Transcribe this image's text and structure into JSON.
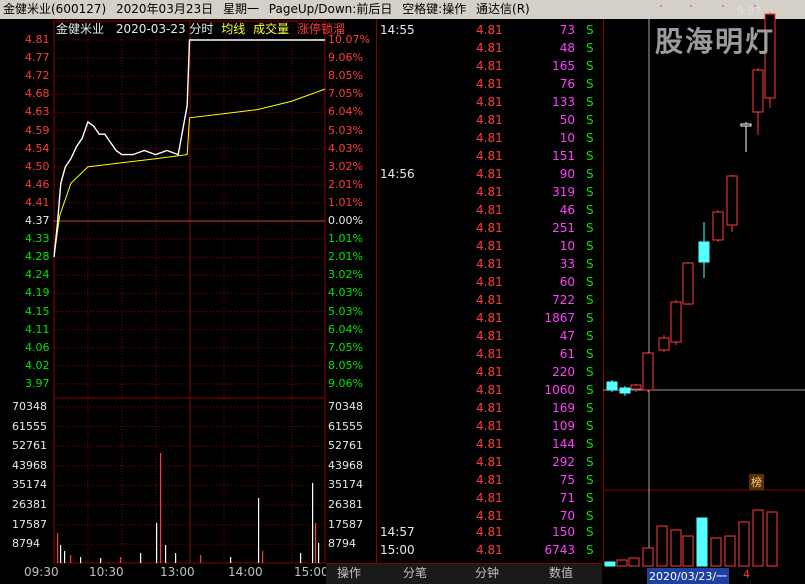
{
  "window": {
    "title_parts": [
      "金健米业(600127)",
      "2020年03月23日",
      "星期一",
      "PageUp/Down:前后日",
      "空格键:操作",
      "通达信(R)"
    ]
  },
  "intraday": {
    "stock_name": "金健米业",
    "header_date": "2020-03-23",
    "header_mode": "分时",
    "legend_avg": "均线",
    "legend_vol": "成交量",
    "legend_limit": "涨停锁溜",
    "price_ticks": [
      "4.81",
      "4.77",
      "4.72",
      "4.68",
      "4.63",
      "4.59",
      "4.54",
      "4.50",
      "4.46",
      "4.41",
      "4.37",
      "4.33",
      "4.28",
      "4.24",
      "4.19",
      "4.15",
      "4.11",
      "4.06",
      "4.02",
      "3.97"
    ],
    "pct_ticks": [
      "10.07%",
      "9.06%",
      "8.05%",
      "7.05%",
      "6.04%",
      "5.03%",
      "4.03%",
      "3.02%",
      "2.01%",
      "1.01%",
      "0.00%",
      "1.01%",
      "2.01%",
      "3.02%",
      "4.03%",
      "5.03%",
      "6.04%",
      "7.05%",
      "8.05%",
      "9.06%"
    ],
    "volume_ticks": [
      "70348",
      "61555",
      "52761",
      "43968",
      "35174",
      "26381",
      "17587",
      "8794"
    ],
    "time_labels": [
      "09:30",
      "10:30",
      "13:00",
      "14:00",
      "15:00"
    ],
    "colors": {
      "up": "#ff3c3c",
      "down": "#00e600",
      "price_line": "#ffffff",
      "avg_line": "#ffff00",
      "grid": "#8b0000"
    }
  },
  "chart_data": [
    {
      "type": "line",
      "title": "",
      "series": [
        {
          "name": "price",
          "x_time": [
            "09:30",
            "09:33",
            "09:36",
            "09:40",
            "09:45",
            "09:50",
            "09:55",
            "10:00",
            "10:05",
            "10:10",
            "10:15",
            "10:20",
            "10:25",
            "10:30",
            "10:40",
            "10:50",
            "11:00",
            "11:10",
            "11:20",
            "11:28",
            "13:00",
            "14:00",
            "14:30",
            "15:00"
          ],
          "values": [
            4.28,
            4.36,
            4.46,
            4.5,
            4.52,
            4.55,
            4.57,
            4.61,
            4.6,
            4.58,
            4.58,
            4.56,
            4.54,
            4.53,
            4.53,
            4.54,
            4.53,
            4.54,
            4.53,
            4.65,
            4.81,
            4.81,
            4.81,
            4.81
          ]
        },
        {
          "name": "avg",
          "x_time": [
            "09:30",
            "09:35",
            "09:45",
            "10:00",
            "10:30",
            "11:00",
            "11:28",
            "13:00",
            "13:30",
            "14:00",
            "14:30",
            "15:00"
          ],
          "values": [
            4.28,
            4.38,
            4.46,
            4.5,
            4.51,
            4.52,
            4.53,
            4.62,
            4.63,
            4.64,
            4.66,
            4.69
          ]
        }
      ],
      "ylim": [
        3.97,
        4.81
      ]
    }
  ],
  "ticks": {
    "rows": [
      {
        "time": "14:55",
        "price": "4.81",
        "vol": "73",
        "flag": "S"
      },
      {
        "time": "",
        "price": "4.81",
        "vol": "48",
        "flag": "S"
      },
      {
        "time": "",
        "price": "4.81",
        "vol": "165",
        "flag": "S"
      },
      {
        "time": "",
        "price": "4.81",
        "vol": "76",
        "flag": "S"
      },
      {
        "time": "",
        "price": "4.81",
        "vol": "133",
        "flag": "S"
      },
      {
        "time": "",
        "price": "4.81",
        "vol": "50",
        "flag": "S"
      },
      {
        "time": "",
        "price": "4.81",
        "vol": "10",
        "flag": "S"
      },
      {
        "time": "",
        "price": "4.81",
        "vol": "151",
        "flag": "S"
      },
      {
        "time": "14:56",
        "price": "4.81",
        "vol": "90",
        "flag": "S"
      },
      {
        "time": "",
        "price": "4.81",
        "vol": "319",
        "flag": "S"
      },
      {
        "time": "",
        "price": "4.81",
        "vol": "46",
        "flag": "S"
      },
      {
        "time": "",
        "price": "4.81",
        "vol": "251",
        "flag": "S"
      },
      {
        "time": "",
        "price": "4.81",
        "vol": "10",
        "flag": "S"
      },
      {
        "time": "",
        "price": "4.81",
        "vol": "33",
        "flag": "S"
      },
      {
        "time": "",
        "price": "4.81",
        "vol": "60",
        "flag": "S"
      },
      {
        "time": "",
        "price": "4.81",
        "vol": "722",
        "flag": "S"
      },
      {
        "time": "",
        "price": "4.81",
        "vol": "1867",
        "flag": "S"
      },
      {
        "time": "",
        "price": "4.81",
        "vol": "47",
        "flag": "S"
      },
      {
        "time": "",
        "price": "4.81",
        "vol": "61",
        "flag": "S"
      },
      {
        "time": "",
        "price": "4.81",
        "vol": "220",
        "flag": "S"
      },
      {
        "time": "",
        "price": "4.81",
        "vol": "1060",
        "flag": "S"
      },
      {
        "time": "",
        "price": "4.81",
        "vol": "169",
        "flag": "S"
      },
      {
        "time": "",
        "price": "4.81",
        "vol": "109",
        "flag": "S"
      },
      {
        "time": "",
        "price": "4.81",
        "vol": "144",
        "flag": "S"
      },
      {
        "time": "",
        "price": "4.81",
        "vol": "292",
        "flag": "S"
      },
      {
        "time": "",
        "price": "4.81",
        "vol": "75",
        "flag": "S"
      },
      {
        "time": "",
        "price": "4.81",
        "vol": "71",
        "flag": "S"
      },
      {
        "time": "",
        "price": "4.81",
        "vol": "70",
        "flag": "S"
      },
      {
        "time": "14:57",
        "price": "4.81",
        "vol": "150",
        "flag": "S"
      },
      {
        "time": "15:00",
        "price": "4.81",
        "vol": "6743",
        "flag": "S"
      }
    ]
  },
  "bottom_tabs": {
    "operate": "操作",
    "ticks": "分笔",
    "minute": "分钟",
    "values": "数值"
  },
  "kline": {
    "watermark": "股海明灯",
    "high_label": "9.87",
    "date_label": "2020/03/23/一",
    "count_label": "4",
    "badge": "榜"
  }
}
